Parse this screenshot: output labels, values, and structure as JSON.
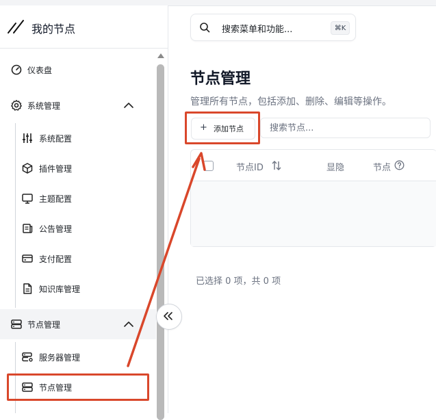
{
  "brand": {
    "title": "我的节点",
    "icon": "slash-logo-icon"
  },
  "sidebar": {
    "items": [
      {
        "label": "仪表盘",
        "icon": "dashboard-icon"
      },
      {
        "label": "系统管理",
        "icon": "gear-icon",
        "expanded": true,
        "children": [
          {
            "label": "系统配置",
            "icon": "sliders-icon"
          },
          {
            "label": "插件管理",
            "icon": "cube-icon"
          },
          {
            "label": "主题配置",
            "icon": "monitor-icon"
          },
          {
            "label": "公告管理",
            "icon": "notice-icon"
          },
          {
            "label": "支付配置",
            "icon": "credit-card-icon"
          },
          {
            "label": "知识库管理",
            "icon": "file-text-icon"
          }
        ]
      },
      {
        "label": "节点管理",
        "icon": "server-icon",
        "expanded": true,
        "children": [
          {
            "label": "服务器管理",
            "icon": "server-gear-icon"
          },
          {
            "label": "节点管理",
            "icon": "server-icon",
            "active": true
          }
        ]
      }
    ]
  },
  "search": {
    "placeholder": "搜索菜单和功能...",
    "shortcut": "⌘K"
  },
  "page": {
    "title": "节点管理",
    "description": "管理所有节点，包括添加、删除、编辑等操作。"
  },
  "toolbar": {
    "add_label": "添加节点",
    "add_icon": "+",
    "search_placeholder": "搜索节点..."
  },
  "table": {
    "columns": [
      "节点ID",
      "显隐",
      "节点"
    ]
  },
  "footer": {
    "selection_text": "已选择 0 项，共 0 项"
  },
  "colors": {
    "annotation": "#d9472b",
    "accent_bg": "#f3f4f6"
  }
}
